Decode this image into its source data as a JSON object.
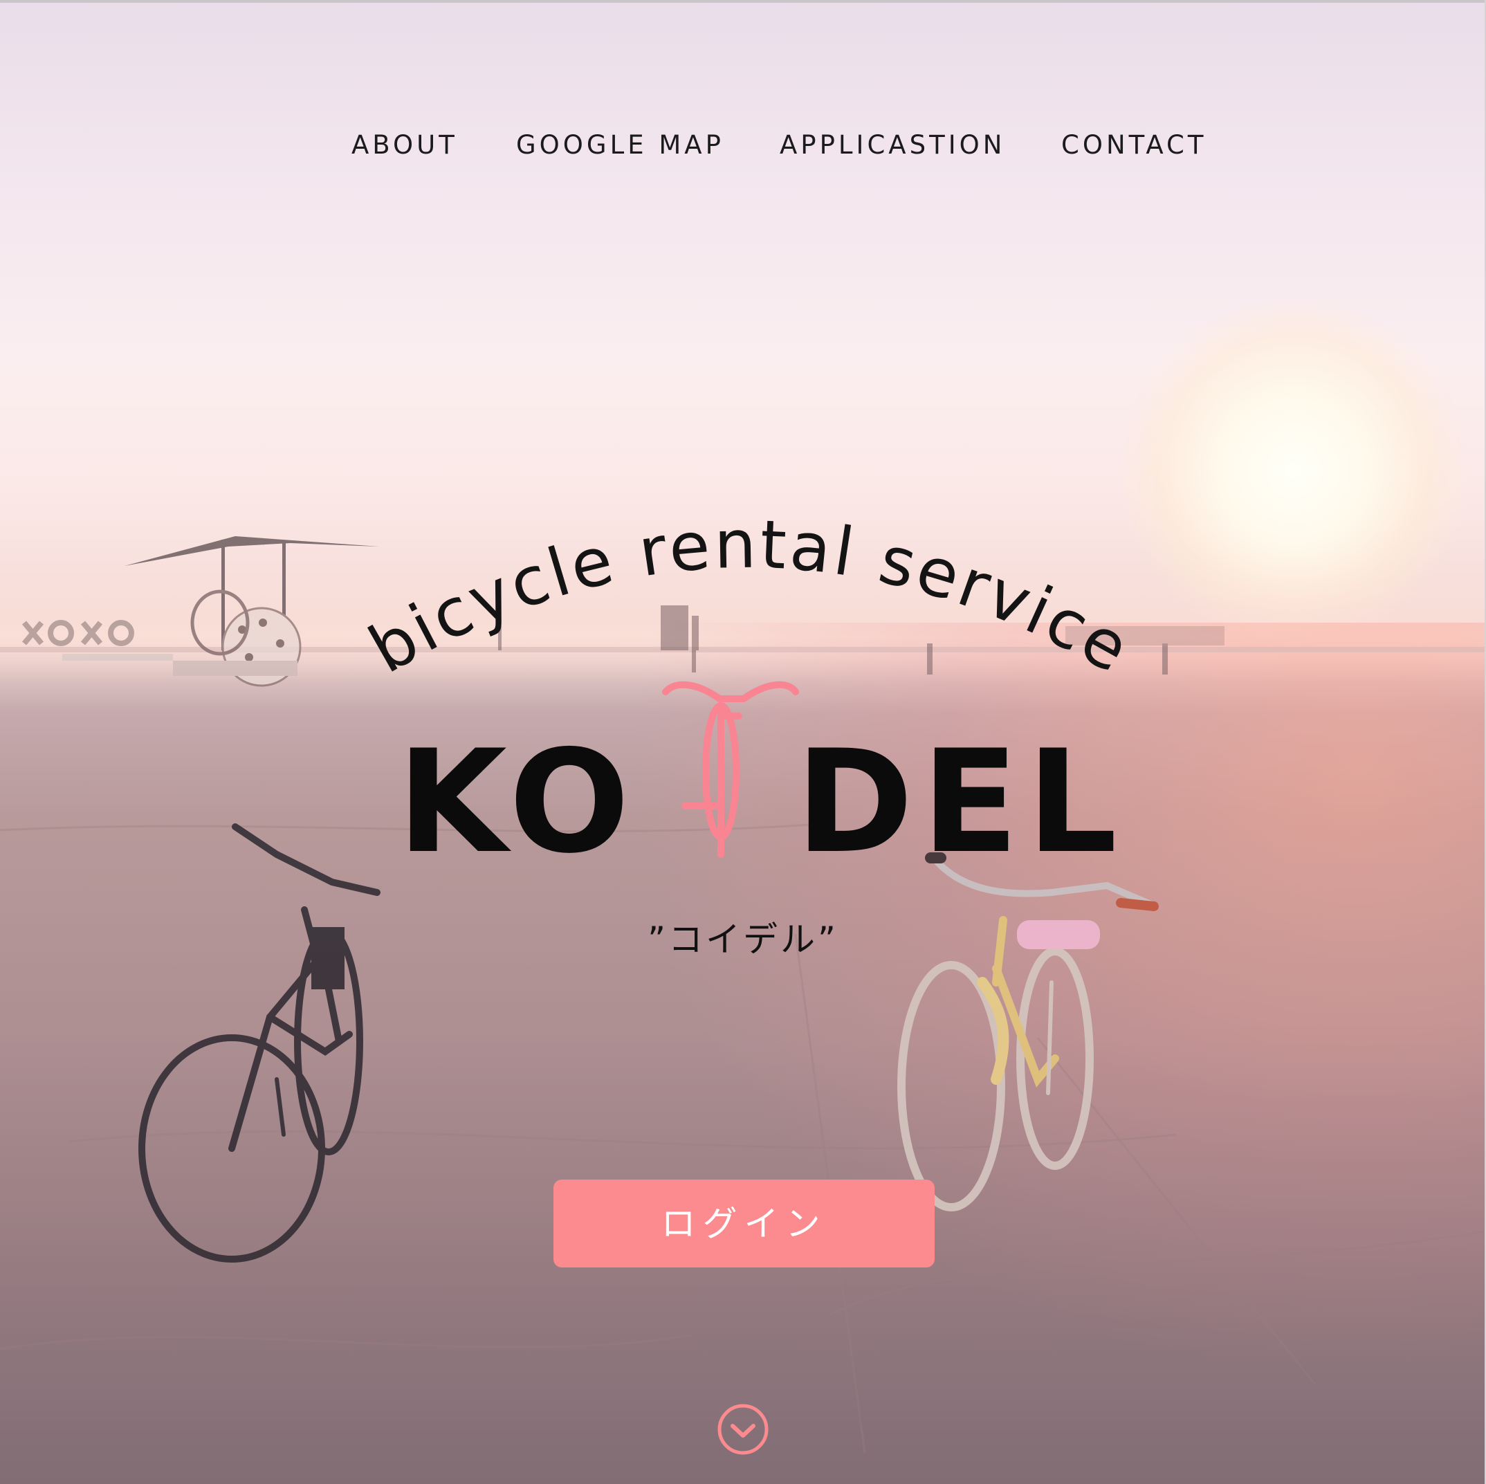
{
  "nav": {
    "items": [
      {
        "label": "ABOUT"
      },
      {
        "label": "GOOGLE MAP"
      },
      {
        "label": "APPLICASTION"
      },
      {
        "label": "CONTACT"
      }
    ]
  },
  "hero": {
    "arc_text": "bicycle rental service",
    "brand_left": "KO",
    "brand_right": "DEL",
    "tagline": "”コイデル”"
  },
  "login": {
    "label": "ログイン"
  },
  "icons": {
    "scroll": "chevron-down-circle-icon",
    "brand_bike": "bicycle-icon"
  },
  "colors": {
    "accent": "#fb8b8e",
    "brand_bike": "#f98593",
    "text": "#111111"
  }
}
